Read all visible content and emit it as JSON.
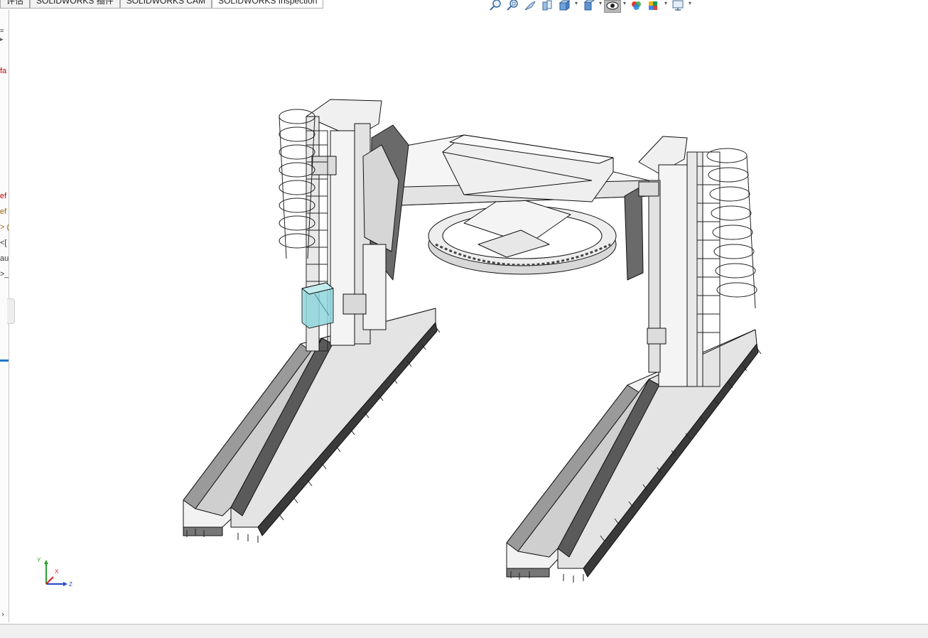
{
  "tabs": [
    {
      "label": "评估"
    },
    {
      "label": "SOLIDWORKS 插件"
    },
    {
      "label": "SOLIDWORKS CAM"
    },
    {
      "label": "SOLIDWORKS Inspection"
    }
  ],
  "sidebar": {
    "fragments": [
      {
        "text": "fa",
        "color": "#c00000"
      },
      {
        "text": "ef",
        "color": "#c00000"
      },
      {
        "text": "ef",
        "color": "#a06000"
      },
      {
        "text": "> (",
        "color": "#a06000"
      },
      {
        "text": "<[",
        "color": "#333333"
      },
      {
        "text": "au",
        "color": "#333333"
      },
      {
        "text": ">_",
        "color": "#333333"
      }
    ],
    "expander_glyph": "›"
  },
  "toolbar": {
    "icons": [
      "zoom-to-fit-icon",
      "zoom-to-area-icon",
      "previous-view-icon",
      "section-view-icon",
      "view-orientation-icon",
      "display-style-icon",
      "hide-show-items-icon",
      "edit-appearance-icon",
      "apply-scene-icon",
      "view-settings-icon"
    ],
    "caret": "▾"
  },
  "triad": {
    "y": "Y",
    "x": "X",
    "z": "Z"
  },
  "colors": {
    "model_fill": "#f2f2f2",
    "model_shade": "#555555",
    "model_edge": "#111111",
    "glass": "#8fd6dc",
    "accent": "#1f77c8"
  }
}
